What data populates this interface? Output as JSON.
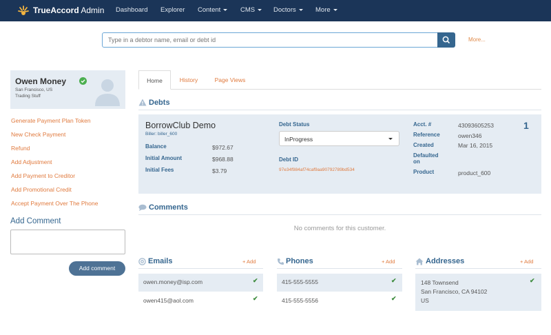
{
  "nav": {
    "brand_bold": "TrueAccord",
    "brand_rest": " Admin",
    "items": [
      "Dashboard",
      "Explorer",
      "Content",
      "CMS",
      "Doctors",
      "More"
    ]
  },
  "search": {
    "placeholder": "Type in a debtor name, email or debt id",
    "more": "More..."
  },
  "profile": {
    "name": "Owen Money",
    "location": "San Francisco, US",
    "occupation": "Trading Stuff"
  },
  "actions": [
    "Generate Payment Plan Token",
    "New Check Payment",
    "Refund",
    "Add Adjustment",
    "Add Payment to Creditor",
    "Add Promotional Credit",
    "Accept Payment Over The Phone"
  ],
  "comment_form": {
    "title": "Add Comment",
    "button": "Add comment"
  },
  "tabs": [
    "Home",
    "History",
    "Page Views"
  ],
  "debts": {
    "title": "Debts",
    "creditor": "BorrowClub Demo",
    "biller": "Biller: biller_600",
    "balance_label": "Balance",
    "balance": "$972.67",
    "initial_amount_label": "Initial Amount",
    "initial_amount": "$968.88",
    "initial_fees_label": "Initial Fees",
    "initial_fees": "$3.79",
    "status_label": "Debt Status",
    "status": "InProgress",
    "debt_id_label": "Debt ID",
    "debt_id": "97e34f984af74caf9aa90792789bd534",
    "acct_label": "Acct. #",
    "acct": "43093605253",
    "reference_label": "Reference",
    "reference": "owen346",
    "created_label": "Created",
    "created": "Mar 16, 2015",
    "defaulted_label_1": "Defaulted",
    "defaulted_label_2": "on",
    "product_label": "Product",
    "product": "product_600",
    "count": "1"
  },
  "comments": {
    "title": "Comments",
    "empty": "No comments for this customer."
  },
  "emails": {
    "title": "Emails",
    "add": "+ Add",
    "items": [
      "owen.money@isp.com",
      "owen415@aol.com"
    ]
  },
  "phones": {
    "title": "Phones",
    "add": "+ Add",
    "items": [
      "415-555-5555",
      "415-555-5556"
    ]
  },
  "addresses": {
    "title": "Addresses",
    "add": "+ Add",
    "lines": [
      "148 Townsend",
      "San Francisco, CA 94102",
      "US"
    ]
  },
  "colors": {
    "navbar": "#1b3558",
    "accent_orange": "#e07a3e",
    "heading_blue": "#35668f",
    "panel_bg": "#e5ecf3",
    "check_green": "#3d8b3d"
  }
}
